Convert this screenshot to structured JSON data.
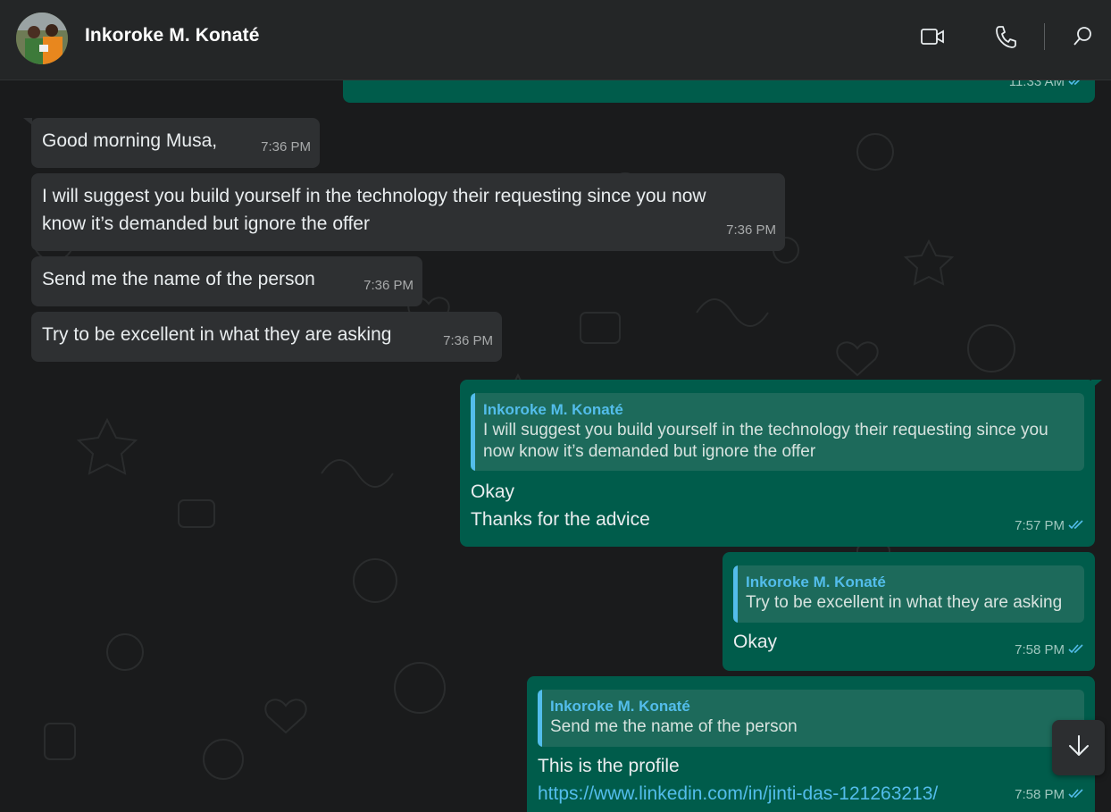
{
  "header": {
    "contact_name": "Inkoroke M. Konaté",
    "icons": [
      "video-call-icon",
      "voice-call-icon",
      "search-icon"
    ]
  },
  "messages": [
    {
      "direction": "out",
      "text": "",
      "time": "11:33 AM",
      "status": "read"
    },
    {
      "direction": "in",
      "text": "Good morning Musa,",
      "time": "7:36 PM"
    },
    {
      "direction": "in",
      "text_lines": [
        "I will suggest you build yourself in the technology their requesting since you now",
        "know it’s demanded but ignore the offer"
      ],
      "time": "7:36 PM"
    },
    {
      "direction": "in",
      "text": "Send me the name of the person",
      "time": "7:36 PM"
    },
    {
      "direction": "in",
      "text": "Try to be excellent in what they are asking",
      "time": "7:36 PM"
    },
    {
      "direction": "out",
      "quote": {
        "name": "Inkoroke M. Konaté",
        "text_lines": [
          "I will suggest you build yourself in the technology their requesting since you",
          "now know it’s demanded but ignore the offer"
        ]
      },
      "text_lines": [
        "Okay",
        "Thanks for the advice"
      ],
      "time": "7:57 PM",
      "status": "read"
    },
    {
      "direction": "out",
      "quote": {
        "name": "Inkoroke M. Konaté",
        "text": "Try to be excellent in what they are asking"
      },
      "text": "Okay",
      "time": "7:58 PM",
      "status": "read"
    },
    {
      "direction": "out",
      "quote": {
        "name": "Inkoroke M. Konaté",
        "text": "Send me the name of the person"
      },
      "text": "This is the profile",
      "link": "https://www.linkedin.com/in/jinti-das-121263213/",
      "time": "7:58 PM",
      "status": "read"
    }
  ],
  "colors": {
    "accent": "#53bdeb",
    "outgoing_bubble": "#005c4b",
    "incoming_bubble": "#2e3032"
  },
  "scroll_button": {
    "icon": "arrow-down-icon"
  }
}
